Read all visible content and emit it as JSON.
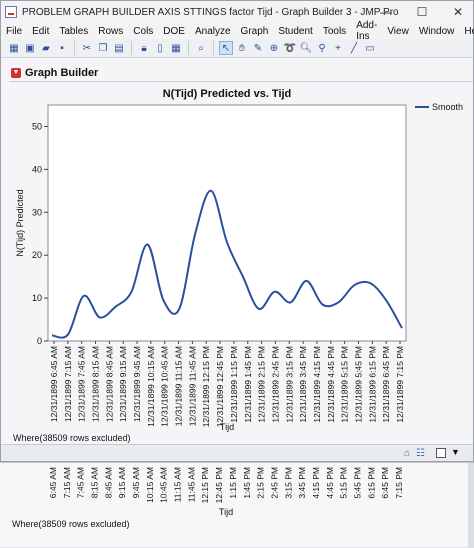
{
  "window": {
    "title": "PROBLEM GRAPH BUILDER AXIS STTINGS factor Tijd - Graph Builder 3 - JMP Pro",
    "minimize_icon": "minimize-icon",
    "maximize_icon": "maximize-icon",
    "close_icon": "close-icon"
  },
  "menu": [
    "File",
    "Edit",
    "Tables",
    "Rows",
    "Cols",
    "DOE",
    "Analyze",
    "Graph",
    "Student",
    "Tools",
    "Add-Ins",
    "View",
    "Window",
    "Help"
  ],
  "toolbar": {
    "icons": [
      "new-data-table-icon",
      "open-icon",
      "open-folder-icon",
      "save-icon",
      "cut-icon",
      "copy-icon",
      "paste-icon",
      "lock-icon",
      "document-icon",
      "data-grid-icon",
      "search-icon",
      "arrow-select-icon",
      "grabber-icon",
      "brush-icon",
      "crosshair-icon",
      "lasso-icon",
      "magnifier-icon",
      "zoom-icon",
      "plus-icon",
      "line-icon",
      "annotate-icon"
    ]
  },
  "report": {
    "header": "Graph Builder"
  },
  "chart_data": {
    "type": "line",
    "title": "N(Tijd) Predicted vs. Tijd",
    "xlabel": "Tijd",
    "ylabel": "N(Tijd) Predicted",
    "ylim": [
      0,
      55
    ],
    "yticks": [
      0,
      10,
      20,
      30,
      40,
      50
    ],
    "grid": false,
    "legend": "right",
    "series": [
      {
        "name": "Smooth",
        "color": "#2a4fa0",
        "values": [
          1.3,
          1.5,
          10.5,
          5.5,
          8.0,
          11.5,
          22.5,
          9.5,
          7.5,
          25.0,
          35.0,
          23.0,
          15.0,
          7.5,
          11.5,
          9.0,
          14.0,
          8.5,
          9.0,
          13.0,
          13.5,
          9.5,
          3.0
        ]
      }
    ],
    "categories": [
      "12/31/1899 6:45 AM",
      "12/31/1899 7:15 AM",
      "12/31/1899 7:45 AM",
      "12/31/1899 8:15 AM",
      "12/31/1899 8:45 AM",
      "12/31/1899 9:15 AM",
      "12/31/1899 9:45 AM",
      "12/31/1899 10:15 AM",
      "12/31/1899 10:45 AM",
      "12/31/1899 11:15 AM",
      "12/31/1899 11:45 AM",
      "12/31/1899 12:15 PM",
      "12/31/1899 12:45 PM",
      "12/31/1899 1:15 PM",
      "12/31/1899 1:45 PM",
      "12/31/1899 2:15 PM",
      "12/31/1899 2:45 PM",
      "12/31/1899 3:15 PM",
      "12/31/1899 3:45 PM",
      "12/31/1899 4:15 PM",
      "12/31/1899 4:45 PM",
      "12/31/1899 5:15 PM",
      "12/31/1899 5:45 PM",
      "12/31/1899 6:15 PM",
      "12/31/1899 6:45 PM",
      "12/31/1899 7:15 PM"
    ]
  },
  "ghost_axis": {
    "labels": [
      "6:45 AM",
      "7:15 AM",
      "7:45 AM",
      "8:15 AM",
      "8:45 AM",
      "9:15 AM",
      "9:45 AM",
      "10:15 AM",
      "10:45 AM",
      "11:15 AM",
      "11:45 AM",
      "12:15 PM",
      "12:45 PM",
      "1:15 PM",
      "1:45 PM",
      "2:15 PM",
      "2:45 PM",
      "3:15 PM",
      "3:45 PM",
      "4:15 PM",
      "4:45 PM",
      "5:15 PM",
      "5:45 PM",
      "6:15 PM",
      "6:45 PM",
      "7:15 PM"
    ],
    "xlabel": "Tijd"
  },
  "status": {
    "where": "Where(38509 rows excluded)",
    "where_ghost": "Where(38509 rows excluded)"
  }
}
